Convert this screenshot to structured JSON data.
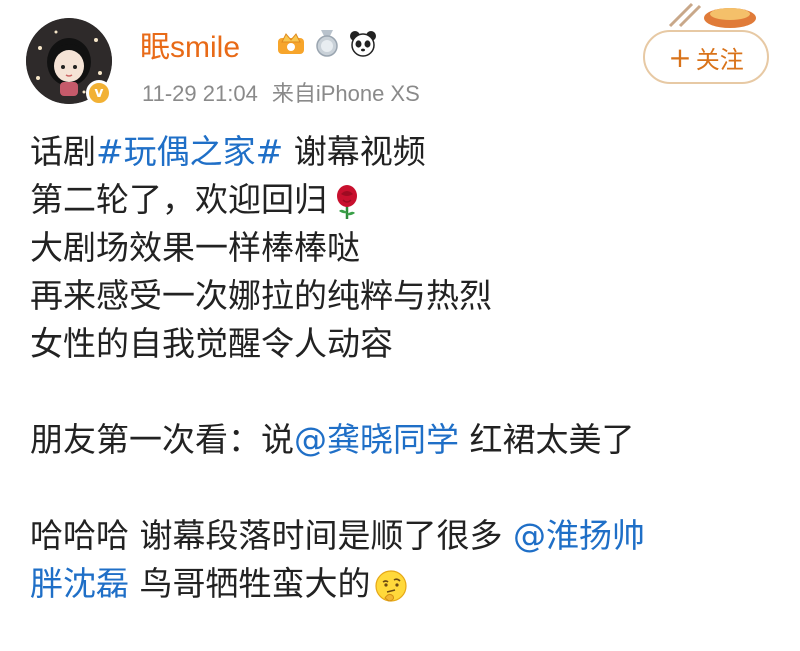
{
  "post": {
    "username": "眠smile",
    "time": "11-29 21:04",
    "source": "来自iPhone XS",
    "follow_label": "关注",
    "follow_plus": "+",
    "avatar_badge": "v",
    "lines": {
      "l1_pre": "话剧",
      "l1_tag": "#玩偶之家#",
      "l1_post": " 谢幕视频",
      "l2": "第二轮了，欢迎回归",
      "l3": "大剧场效果一样棒棒哒",
      "l4": "再来感受一次娜拉的纯粹与热烈",
      "l5": "女性的自我觉醒令人动容",
      "l6_pre": "朋友第一次看：说",
      "l6_mention": "@龚晓同学",
      "l6_post": " 红裙太美了",
      "l7_pre": "哈哈哈 谢幕段落时间是顺了很多 ",
      "l7_mention": "@淮扬帅",
      "l8_mention": "胖沈磊",
      "l8_post": " 鸟哥牺牲蛮大的"
    },
    "icons": [
      "crown-vip-icon",
      "medal-icon",
      "panda-icon",
      "rose-emoji-icon",
      "thinking-emoji-icon"
    ],
    "colors": {
      "username": "#e86a17",
      "link": "#1f6fc7",
      "follow_border": "#e7c9a4",
      "follow_text": "#d9731a",
      "meta": "#8a8a8a"
    }
  }
}
